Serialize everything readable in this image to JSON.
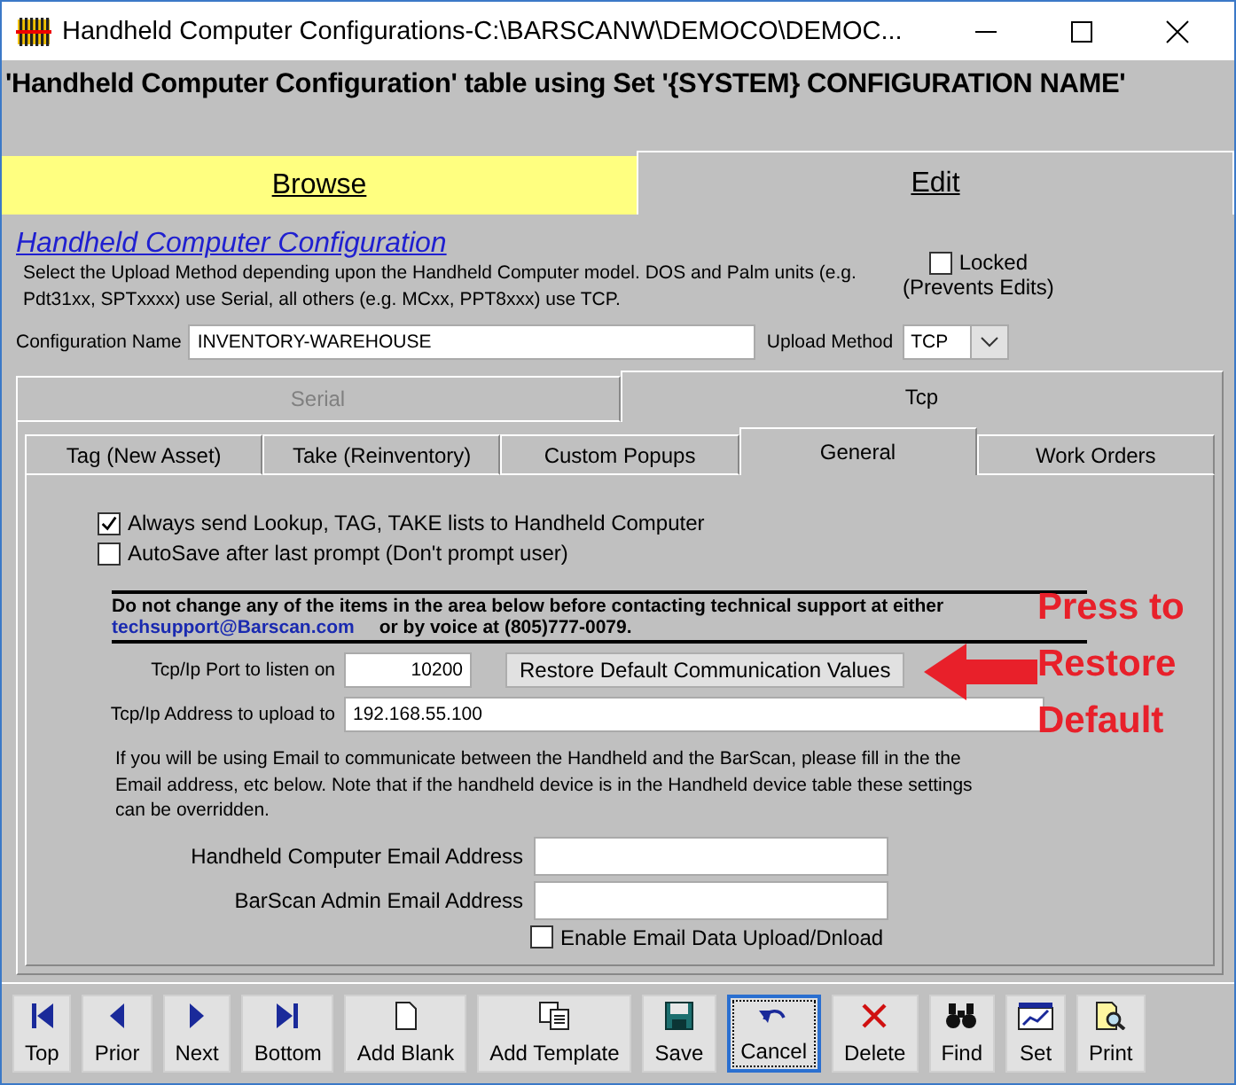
{
  "window": {
    "title": "Handheld Computer Configurations-C:\\BARSCANW\\DEMOCO\\DEMOC..."
  },
  "header": "'Handheld Computer Configuration' table using Set '{SYSTEM} CONFIGURATION NAME'",
  "view_tabs": [
    {
      "label": "Browse",
      "selected": false
    },
    {
      "label": "Edit",
      "selected": true
    }
  ],
  "form": {
    "title": "Handheld Computer Configuration",
    "description": "Select the Upload Method depending upon the Handheld Computer model. DOS and Palm units (e.g. Pdt31xx, SPTxxxx) use Serial, all others (e.g. MCxx, PPT8xxx) use TCP.",
    "locked": {
      "label": "Locked",
      "note": "(Prevents Edits)",
      "checked": false
    },
    "config_name": {
      "label": "Configuration Name",
      "value": "INVENTORY-WAREHOUSE"
    },
    "upload_method": {
      "label": "Upload Method",
      "value": "TCP"
    }
  },
  "method_tabs": [
    {
      "label": "Serial",
      "selected": false,
      "disabled": true
    },
    {
      "label": "Tcp",
      "selected": true,
      "disabled": false
    }
  ],
  "sub_tabs": [
    {
      "label": "Tag (New Asset)",
      "selected": false
    },
    {
      "label": "Take (Reinventory)",
      "selected": false
    },
    {
      "label": "Custom Popups",
      "selected": false
    },
    {
      "label": "General",
      "selected": true
    },
    {
      "label": "Work Orders",
      "selected": false
    }
  ],
  "options": [
    {
      "label": "Always send Lookup, TAG, TAKE lists to Handheld Computer",
      "checked": true
    },
    {
      "label": "AutoSave after last prompt (Don't prompt user)",
      "checked": false
    }
  ],
  "warning": {
    "text": "Do not change any of the items in the area below before contacting technical support at either",
    "email": "techsupport@Barscan.com",
    "voice": "or by voice at (805)777-0079."
  },
  "port": {
    "label": "Tcp/Ip Port to listen on",
    "value": "10200"
  },
  "restore_button": "Restore Default Communication Values",
  "annotation": "Press to Restore Default",
  "address": {
    "label": "Tcp/Ip Address to upload to",
    "value": "192.168.55.100"
  },
  "email_note": "If you will be using Email to communicate between the Handheld and the BarScan, please fill in the the Email address, etc below. Note that if the handheld device is in the Handheld device table these settings can be overridden.",
  "email_fields": [
    {
      "label": "Handheld Computer Email Address"
    },
    {
      "label": "BarScan Admin Email Address"
    }
  ],
  "enable_email": {
    "label": "Enable Email Data Upload/Dnload",
    "checked": false
  },
  "toolbar": [
    {
      "label": "Top",
      "kind": "first",
      "focused": false
    },
    {
      "label": "Prior",
      "kind": "prev",
      "focused": false
    },
    {
      "label": "Next",
      "kind": "next",
      "focused": false
    },
    {
      "label": "Bottom",
      "kind": "last",
      "focused": false
    },
    {
      "label": "Add Blank",
      "kind": "page",
      "focused": false
    },
    {
      "label": "Add Template",
      "kind": "pages",
      "focused": false
    },
    {
      "label": "Save",
      "kind": "save",
      "focused": false
    },
    {
      "label": "Cancel",
      "kind": "undo",
      "focused": true
    },
    {
      "label": "Delete",
      "kind": "delete",
      "focused": false
    },
    {
      "label": "Find",
      "kind": "binoculars",
      "focused": false
    },
    {
      "label": "Set",
      "kind": "set",
      "focused": false
    },
    {
      "label": "Print",
      "kind": "print",
      "focused": false
    }
  ]
}
